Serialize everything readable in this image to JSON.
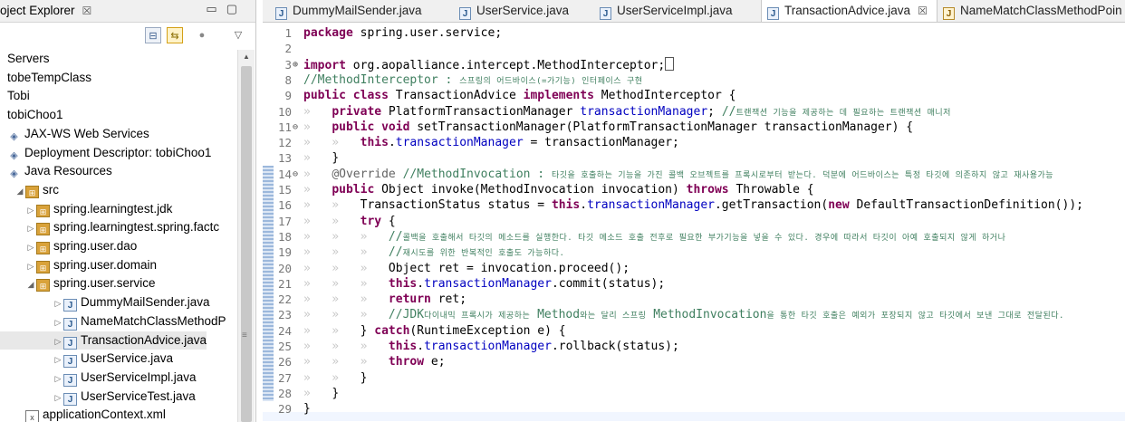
{
  "explorer": {
    "title": "oject Explorer",
    "close": "☒",
    "window_buttons": "▭▢",
    "tree": [
      {
        "label": "Servers",
        "indent": 0,
        "twisty": "",
        "icon": ""
      },
      {
        "label": "tobeTempClass",
        "indent": 0,
        "twisty": "",
        "icon": ""
      },
      {
        "label": "Tobi",
        "indent": 0,
        "twisty": "",
        "icon": ""
      },
      {
        "label": "tobiChoo1",
        "indent": 0,
        "twisty": "",
        "icon": ""
      },
      {
        "label": "JAX-WS Web Services",
        "indent": 1,
        "twisty": "",
        "icon": "misc"
      },
      {
        "label": "Deployment Descriptor: tobiChoo1",
        "indent": 1,
        "twisty": "",
        "icon": "misc"
      },
      {
        "label": "Java Resources",
        "indent": 1,
        "twisty": "",
        "icon": "misc"
      },
      {
        "label": "src",
        "indent": 2,
        "twisty": "◢",
        "icon": "pkg"
      },
      {
        "label": "spring.learningtest.jdk",
        "indent": 3,
        "twisty": "▷",
        "icon": "pkg"
      },
      {
        "label": "spring.learningtest.spring.factc",
        "indent": 3,
        "twisty": "▷",
        "icon": "pkg"
      },
      {
        "label": "spring.user.dao",
        "indent": 3,
        "twisty": "▷",
        "icon": "pkg"
      },
      {
        "label": "spring.user.domain",
        "indent": 3,
        "twisty": "▷",
        "icon": "pkg"
      },
      {
        "label": "spring.user.service",
        "indent": 3,
        "twisty": "◢",
        "icon": "pkg"
      },
      {
        "label": "DummyMailSender.java",
        "indent": 4,
        "twisty": "▷",
        "icon": "java"
      },
      {
        "label": "NameMatchClassMethodP",
        "indent": 4,
        "twisty": "▷",
        "icon": "java"
      },
      {
        "label": "TransactionAdvice.java",
        "indent": 4,
        "twisty": "▷",
        "icon": "java",
        "selected": true
      },
      {
        "label": "UserService.java",
        "indent": 4,
        "twisty": "▷",
        "icon": "java"
      },
      {
        "label": "UserServiceImpl.java",
        "indent": 4,
        "twisty": "▷",
        "icon": "java"
      },
      {
        "label": "UserServiceTest.java",
        "indent": 4,
        "twisty": "▷",
        "icon": "java"
      },
      {
        "label": "applicationContext.xml",
        "indent": 3,
        "twisty": "",
        "icon": "xml"
      }
    ]
  },
  "editor_tabs": [
    {
      "label": "DummyMailSender.java",
      "active": false,
      "warn": false
    },
    {
      "label": "UserService.java",
      "active": false,
      "warn": false
    },
    {
      "label": "UserServiceImpl.java",
      "active": false,
      "warn": false
    },
    {
      "label": "TransactionAdvice.java",
      "active": true,
      "warn": false
    },
    {
      "label": "NameMatchClassMethodPoin",
      "active": false,
      "warn": true
    }
  ],
  "code_lines": [
    {
      "n": "1",
      "fold": "",
      "html": "<span class=\"kw\">package</span> spring.user.service;"
    },
    {
      "n": "2",
      "fold": "",
      "html": ""
    },
    {
      "n": "3",
      "fold": "⊕",
      "html": "<span class=\"kw\">import</span> org.aopalliance.intercept.MethodInterceptor;<span class=\"cursor-box\"></span>"
    },
    {
      "n": "8",
      "fold": "",
      "html": "<span class=\"cm\">//MethodInterceptor : <span class=\"small\">스프링의 어드바이스(=가기능) 인터페이스 구현</span></span>"
    },
    {
      "n": "9",
      "fold": "",
      "html": "<span class=\"kw\">public class</span> TransactionAdvice <span class=\"kw\">implements</span> MethodInterceptor {"
    },
    {
      "n": "10",
      "fold": "",
      "html": "<span class=\"ws\">»   </span><span class=\"kw\">private</span> PlatformTransactionManager <span class=\"fld\">transactionManager</span>; <span class=\"cm\">//<span class=\"small\">트랜잭션 기능을 제공하는 데 필요하는 트랜잭션 매니저</span></span>"
    },
    {
      "n": "11",
      "fold": "⊖",
      "html": "<span class=\"ws\">»   </span><span class=\"kw\">public void</span> setTransactionManager(PlatformTransactionManager transactionManager) {"
    },
    {
      "n": "12",
      "fold": "",
      "html": "<span class=\"ws\">»   »   </span><span class=\"kw\">this</span>.<span class=\"fld\">transactionManager</span> = transactionManager;"
    },
    {
      "n": "13",
      "fold": "",
      "html": "<span class=\"ws\">»   </span>}"
    },
    {
      "n": "14",
      "fold": "⊖",
      "html": "<span class=\"ws\">»   </span><span class=\"ann\">@Override</span> <span class=\"cm\">//MethodInvocation : <span class=\"small\">타깃을 호출하는 기능을 가진 콜백 오브젝트를 프록시로부터 받는다. 덕분에 어드바이스는 특정 타깃에 의존하지 않고 재사용가능</span></span>"
    },
    {
      "n": "15",
      "fold": "",
      "html": "<span class=\"ws\">»   </span><span class=\"kw\">public</span> Object invoke(MethodInvocation invocation) <span class=\"kw\">throws</span> Throwable {"
    },
    {
      "n": "16",
      "fold": "",
      "html": "<span class=\"ws\">»   »   </span>TransactionStatus status = <span class=\"kw\">this</span>.<span class=\"fld\">transactionManager</span>.getTransaction(<span class=\"kw\">new</span> DefaultTransactionDefinition());"
    },
    {
      "n": "17",
      "fold": "",
      "html": "<span class=\"ws\">»   »   </span><span class=\"kw\">try</span> {"
    },
    {
      "n": "18",
      "fold": "",
      "html": "<span class=\"ws\">»   »   »   </span><span class=\"cm\">//<span class=\"small\">콜백을 호출해서 타깃의 메소드를 실행한다. 타깃 메소드 호출 전후로 필요한 부가기능을 넣을 수 있다. 경우에 따라서 타깃이 아예 호출되지 않게 하거나</span></span>"
    },
    {
      "n": "19",
      "fold": "",
      "html": "<span class=\"ws\">»   »   »   </span><span class=\"cm\">//<span class=\"small\">재시도를 위한 반복적인 호출도 가능하다.</span></span>"
    },
    {
      "n": "20",
      "fold": "",
      "html": "<span class=\"ws\">»   »   »   </span>Object ret = invocation.proceed();"
    },
    {
      "n": "21",
      "fold": "",
      "html": "<span class=\"ws\">»   »   »   </span><span class=\"kw\">this</span>.<span class=\"fld\">transactionManager</span>.commit(status);"
    },
    {
      "n": "22",
      "fold": "",
      "html": "<span class=\"ws\">»   »   »   </span><span class=\"kw\">return</span> ret;"
    },
    {
      "n": "23",
      "fold": "",
      "html": "<span class=\"ws\">»   »   »   </span><span class=\"cm\">//JDK<span class=\"small\">다이내믹 프록시가 제공하는</span> Method<span class=\"small\">와는 달리 스프링</span> MethodInvocation<span class=\"small\">을 통한 타깃 호출은 예외가 포장되지 않고 타깃에서 보낸 그대로 전달된다.</span></span>"
    },
    {
      "n": "24",
      "fold": "",
      "html": "<span class=\"ws\">»   »   </span>} <span class=\"kw\">catch</span>(RuntimeException e) {"
    },
    {
      "n": "25",
      "fold": "",
      "html": "<span class=\"ws\">»   »   »   </span><span class=\"kw\">this</span>.<span class=\"fld\">transactionManager</span>.rollback(status);"
    },
    {
      "n": "26",
      "fold": "",
      "html": "<span class=\"ws\">»   »   »   </span><span class=\"kw\">throw</span> e;"
    },
    {
      "n": "27",
      "fold": "",
      "html": "<span class=\"ws\">»   »   </span>}"
    },
    {
      "n": "28",
      "fold": "",
      "html": "<span class=\"ws\">»   </span>}"
    },
    {
      "n": "29",
      "fold": "",
      "html": "}"
    }
  ]
}
